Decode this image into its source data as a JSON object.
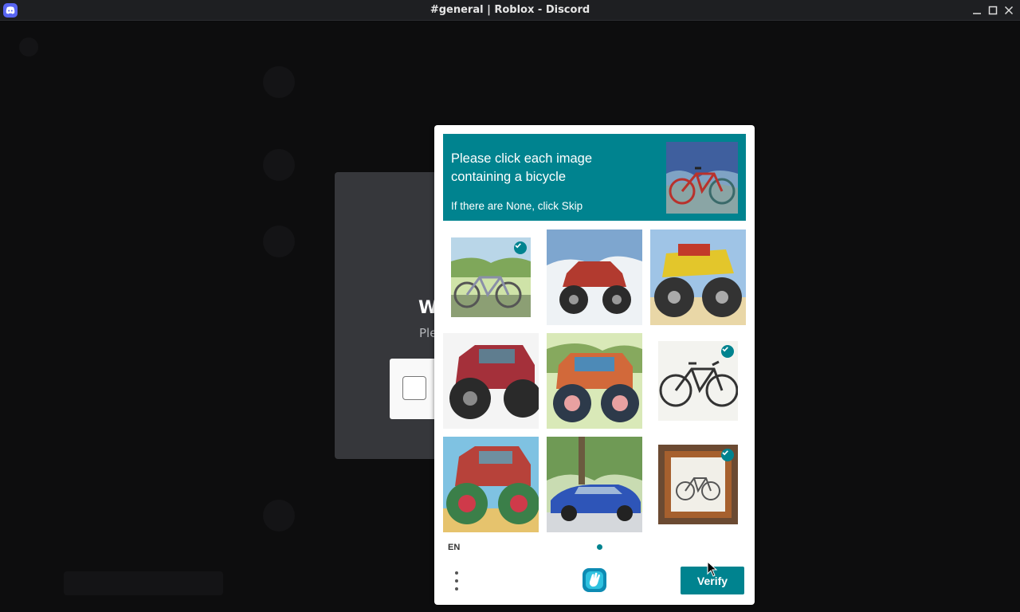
{
  "window": {
    "title": "#general | Roblox - Discord"
  },
  "verify_card": {
    "title_partial": "W",
    "subtitle_partial": "Ple"
  },
  "captcha": {
    "prompt_text": "Please click each image containing a bicycle",
    "skip_hint": "If there are None, click Skip",
    "language": "EN",
    "verify_label": "Verify",
    "accent_color": "#00838f",
    "tiles": [
      {
        "subject": "bicycle in park",
        "selected": true
      },
      {
        "subject": "red monster truck",
        "selected": false
      },
      {
        "subject": "yellow monster truck",
        "selected": false
      },
      {
        "subject": "red monster truck",
        "selected": false
      },
      {
        "subject": "painted monster truck",
        "selected": false
      },
      {
        "subject": "black bicycle",
        "selected": true
      },
      {
        "subject": "red monster truck with colorful wheels",
        "selected": false
      },
      {
        "subject": "blue sports car",
        "selected": false
      },
      {
        "subject": "framed bicycle picture",
        "selected": true
      }
    ]
  }
}
